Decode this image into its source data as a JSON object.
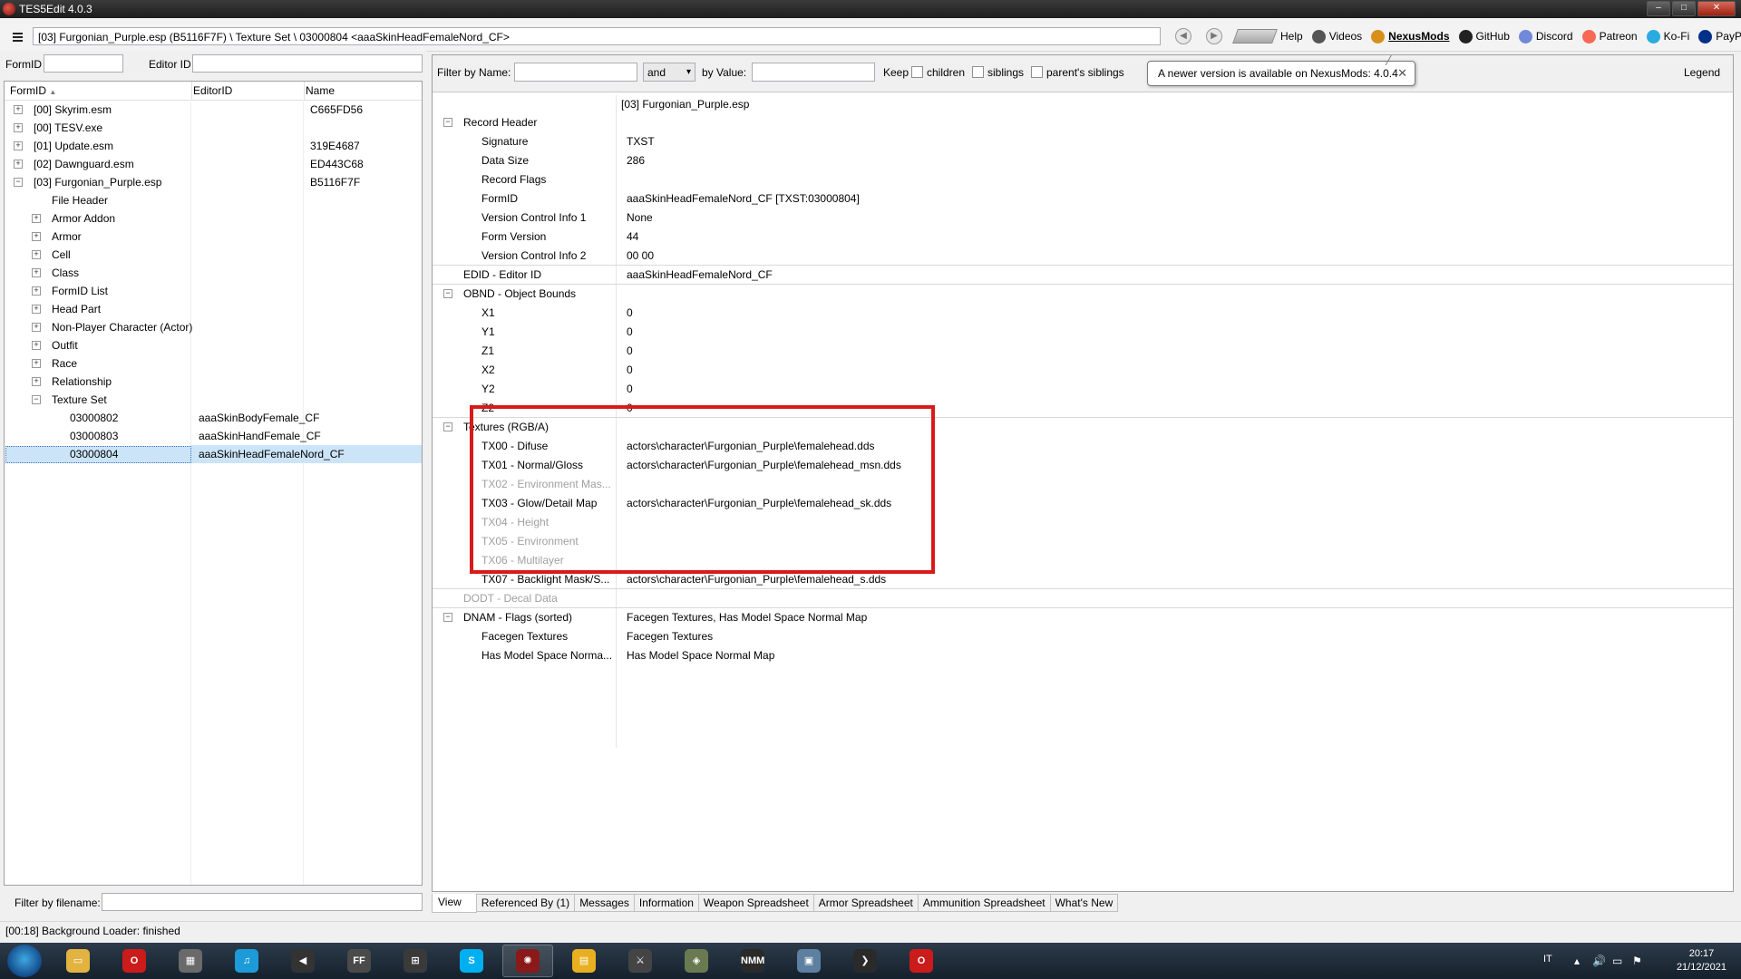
{
  "window": {
    "title": "TES5Edit 4.0.3"
  },
  "toolbar": {
    "path": "[03] Furgonian_Purple.esp (B5116F7F) \\ Texture Set \\ 03000804 <aaaSkinHeadFemaleNord_CF>",
    "links": [
      {
        "label": "Help",
        "icon": "help-book-icon",
        "color": "#888888"
      },
      {
        "label": "Videos",
        "icon": "videos-icon",
        "color": "#555555"
      },
      {
        "label": "NexusMods",
        "icon": "nexusmods-icon",
        "color": "#d98f1c"
      },
      {
        "label": "GitHub",
        "icon": "github-icon",
        "color": "#222222"
      },
      {
        "label": "Discord",
        "icon": "discord-icon",
        "color": "#7289da"
      },
      {
        "label": "Patreon",
        "icon": "patreon-icon",
        "color": "#f96854"
      },
      {
        "label": "Ko-Fi",
        "icon": "kofi-icon",
        "color": "#29abe0"
      },
      {
        "label": "PayPal",
        "icon": "paypal-icon",
        "color": "#003087"
      }
    ]
  },
  "left": {
    "formid_label": "FormID",
    "editorid_label": "Editor ID",
    "columns": [
      "FormID",
      "EditorID",
      "Name"
    ],
    "filter_label": "Filter by filename:",
    "rows": [
      {
        "text": "[00] Skyrim.esm",
        "name": "C665FD56",
        "exp": "+"
      },
      {
        "text": "[00] TESV.exe",
        "name": "",
        "exp": "+"
      },
      {
        "text": "[01] Update.esm",
        "name": "319E4687",
        "exp": "+"
      },
      {
        "text": "[02] Dawnguard.esm",
        "name": "ED443C68",
        "exp": "+"
      },
      {
        "text": "[03] Furgonian_Purple.esp",
        "name": "B5116F7F",
        "exp": "−"
      },
      {
        "text": "File Header",
        "exp": ""
      },
      {
        "text": "Armor Addon",
        "exp": "+"
      },
      {
        "text": "Armor",
        "exp": "+"
      },
      {
        "text": "Cell",
        "exp": "+"
      },
      {
        "text": "Class",
        "exp": "+"
      },
      {
        "text": "FormID List",
        "exp": "+"
      },
      {
        "text": "Head Part",
        "exp": "+"
      },
      {
        "text": "Non-Player Character (Actor)",
        "exp": "+"
      },
      {
        "text": "Outfit",
        "exp": "+"
      },
      {
        "text": "Race",
        "exp": "+"
      },
      {
        "text": "Relationship",
        "exp": "+"
      },
      {
        "text": "Texture Set",
        "exp": "−"
      },
      {
        "text": "03000802",
        "editorid": "aaaSkinBodyFemale_CF"
      },
      {
        "text": "03000803",
        "editorid": "aaaSkinHandFemale_CF"
      },
      {
        "text": "03000804",
        "editorid": "aaaSkinHeadFemaleNord_CF"
      }
    ]
  },
  "filter": {
    "by_name": "Filter by Name:",
    "combo": "and",
    "by_value": "by Value:",
    "keep": "Keep",
    "children": "children",
    "siblings": "siblings",
    "parents_siblings": "parent's siblings",
    "legend": "Legend"
  },
  "banner": {
    "text": "A newer version is available on NexusMods: 4.0.4",
    "close": "✕"
  },
  "record": {
    "header_value": "[03] Furgonian_Purple.esp",
    "rows": [
      {
        "label": "Record Header",
        "value": ""
      },
      {
        "label": "Signature",
        "value": "TXST"
      },
      {
        "label": "Data Size",
        "value": "286"
      },
      {
        "label": "Record Flags",
        "value": ""
      },
      {
        "label": "FormID",
        "value": "aaaSkinHeadFemaleNord_CF [TXST:03000804]"
      },
      {
        "label": "Version Control Info 1",
        "value": "None"
      },
      {
        "label": "Form Version",
        "value": "44"
      },
      {
        "label": "Version Control Info 2",
        "value": "00 00"
      },
      {
        "label": "EDID - Editor ID",
        "value": "aaaSkinHeadFemaleNord_CF"
      },
      {
        "label": "OBND - Object Bounds",
        "value": ""
      },
      {
        "label": "X1",
        "value": "0"
      },
      {
        "label": "Y1",
        "value": "0"
      },
      {
        "label": "Z1",
        "value": "0"
      },
      {
        "label": "X2",
        "value": "0"
      },
      {
        "label": "Y2",
        "value": "0"
      },
      {
        "label": "Z2",
        "value": "0"
      },
      {
        "label": "Textures (RGB/A)",
        "value": ""
      },
      {
        "label": "TX00 - Difuse",
        "value": "actors\\character\\Furgonian_Purple\\femalehead.dds"
      },
      {
        "label": "TX01 - Normal/Gloss",
        "value": "actors\\character\\Furgonian_Purple\\femalehead_msn.dds"
      },
      {
        "label": "TX02 - Environment Mas...",
        "value": ""
      },
      {
        "label": "TX03 - Glow/Detail Map",
        "value": "actors\\character\\Furgonian_Purple\\femalehead_sk.dds"
      },
      {
        "label": "TX04 - Height",
        "value": ""
      },
      {
        "label": "TX05 - Environment",
        "value": ""
      },
      {
        "label": "TX06 - Multilayer",
        "value": ""
      },
      {
        "label": "TX07 - Backlight Mask/S...",
        "value": "actors\\character\\Furgonian_Purple\\femalehead_s.dds"
      },
      {
        "label": "DODT - Decal Data",
        "value": ""
      },
      {
        "label": "DNAM - Flags (sorted)",
        "value": "Facegen Textures, Has Model Space Normal Map"
      },
      {
        "label": "Facegen Textures",
        "value": "Facegen Textures"
      },
      {
        "label": "Has Model Space Norma...",
        "value": "Has Model Space Normal Map"
      }
    ]
  },
  "tabs": [
    "View",
    "Referenced By (1)",
    "Messages",
    "Information",
    "Weapon Spreadsheet",
    "Armor Spreadsheet",
    "Ammunition Spreadsheet",
    "What's New"
  ],
  "status": {
    "text": "[00:18] Background Loader: finished"
  },
  "taskbar": {
    "apps": [
      {
        "icon": "explorer-icon",
        "color": "#e3b341",
        "glyph": "▭"
      },
      {
        "icon": "opera-icon",
        "color": "#cc1b1b",
        "glyph": "O"
      },
      {
        "icon": "calculator-icon",
        "color": "#6a6a6a",
        "glyph": "▦"
      },
      {
        "icon": "music-icon",
        "color": "#1d9bd8",
        "glyph": "♫"
      },
      {
        "icon": "speaker-app-icon",
        "color": "#333333",
        "glyph": "◀"
      },
      {
        "icon": "ffdec-icon",
        "color": "#4a4a4a",
        "glyph": "FF"
      },
      {
        "icon": "tools-icon",
        "color": "#3a3a3a",
        "glyph": "⊞"
      },
      {
        "icon": "skype-icon",
        "color": "#00aff0",
        "glyph": "S"
      },
      {
        "icon": "tes5edit-icon",
        "color": "#8a1a1a",
        "glyph": "✺"
      },
      {
        "icon": "folder-icon",
        "color": "#e8b020",
        "glyph": "▤"
      },
      {
        "icon": "skyrim-icon",
        "color": "#444444",
        "glyph": "⚔"
      },
      {
        "icon": "shield-icon",
        "color": "#6a7a50",
        "glyph": "◈"
      },
      {
        "icon": "nmm-icon",
        "color": "#2a2a2a",
        "glyph": "NMM"
      },
      {
        "icon": "notes-icon",
        "color": "#5d7fa0",
        "glyph": "▣"
      },
      {
        "icon": "arrow-app-icon",
        "color": "#2a2a2a",
        "glyph": "❯"
      },
      {
        "icon": "opera-gx-icon",
        "color": "#cc1b1b",
        "glyph": "O"
      }
    ],
    "lang": "IT",
    "time": "20:17",
    "date": "21/12/2021"
  }
}
